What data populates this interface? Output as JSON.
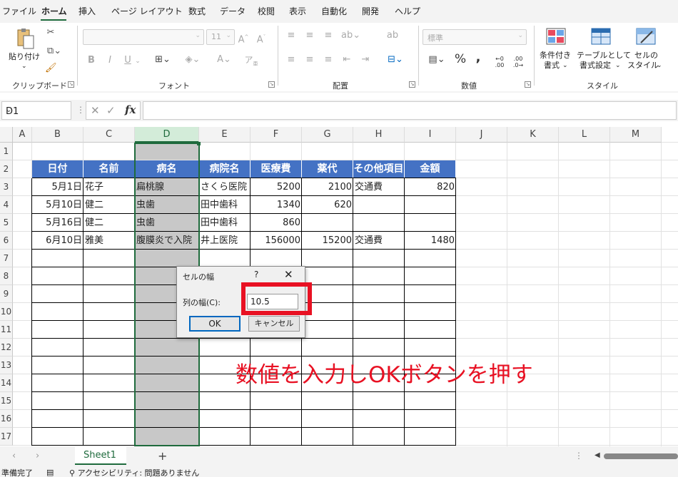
{
  "menu": {
    "items": [
      "ファイル",
      "ホーム",
      "挿入",
      "ページ レイアウト",
      "数式",
      "データ",
      "校閲",
      "表示",
      "自動化",
      "開発",
      "ヘルプ"
    ],
    "active": "ホーム"
  },
  "ribbon": {
    "clipboard": {
      "label": "クリップボード",
      "paste_label": "貼り付け"
    },
    "font": {
      "label": "フォント",
      "size_value": "11",
      "bold": "B",
      "italic": "I",
      "underline": "U"
    },
    "alignment": {
      "label": "配置"
    },
    "number": {
      "label": "数値",
      "format_value": "標準",
      "percent": "%",
      "comma": ",",
      "inc_decimal": ".00",
      "dec_decimal": ".0"
    },
    "styles": {
      "label": "スタイル",
      "conditional_label_1": "条件付き",
      "conditional_label_2": "書式",
      "table_label_1": "テーブルとして",
      "table_label_2": "書式設定",
      "cell_label_1": "セルの",
      "cell_label_2": "スタイル"
    }
  },
  "formula_bar": {
    "name_box": "D1",
    "fx": "fx",
    "value": ""
  },
  "columns": [
    "A",
    "B",
    "C",
    "D",
    "E",
    "F",
    "G",
    "H",
    "I",
    "J",
    "K",
    "L",
    "M"
  ],
  "selected_column": "D",
  "rows": [
    "1",
    "2",
    "3",
    "4",
    "5",
    "6",
    "7",
    "8",
    "9",
    "10",
    "11",
    "12",
    "13",
    "14",
    "15",
    "16",
    "17"
  ],
  "table": {
    "headers": [
      "日付",
      "名前",
      "病名",
      "病院名",
      "医療費",
      "薬代",
      "その他項目",
      "金額"
    ],
    "rows": [
      [
        "5月1日",
        "花子",
        "扁桃腺",
        "さくら医院",
        "5200",
        "2100",
        "交通費",
        "820"
      ],
      [
        "5月10日",
        "健二",
        "虫歯",
        "田中歯科",
        "1340",
        "620",
        "",
        ""
      ],
      [
        "5月16日",
        "健二",
        "虫歯",
        "田中歯科",
        "860",
        "",
        "",
        ""
      ],
      [
        "6月10日",
        "雅美",
        "腹膜炎で入院",
        "井上医院",
        "156000",
        "15200",
        "交通費",
        "1480"
      ]
    ]
  },
  "dialog": {
    "title": "セルの幅",
    "help": "?",
    "close": "✕",
    "label": "列の幅(C):",
    "value": "10.5",
    "ok": "OK",
    "cancel": "キャンセル"
  },
  "annotation": "数値を入力しOKボタンを押す",
  "sheet_tabs": {
    "active": "Sheet1",
    "add": "+"
  },
  "status": {
    "ready": "準備完了",
    "accessibility": "アクセシビリティ: 問題ありません"
  },
  "colors": {
    "accent": "#1f6b3d",
    "header_fill": "#4472c4",
    "highlight": "#e81123"
  }
}
